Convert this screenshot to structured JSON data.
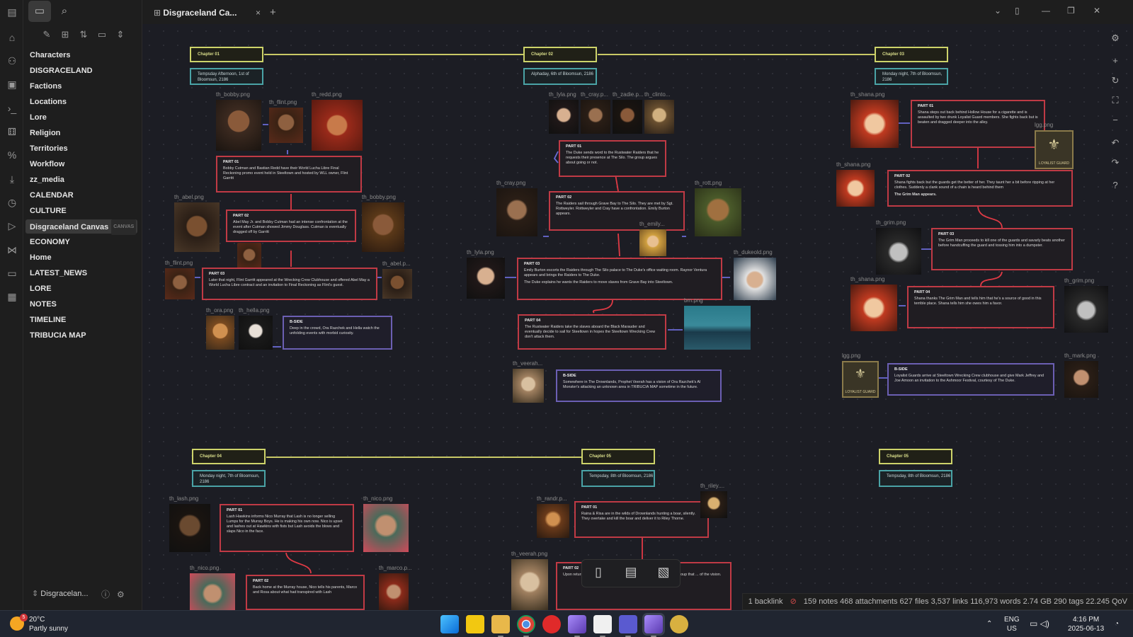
{
  "sidebar": {
    "items": [
      {
        "label": "Characters"
      },
      {
        "label": "DISGRACELAND"
      },
      {
        "label": "Factions"
      },
      {
        "label": "Locations"
      },
      {
        "label": "Lore"
      },
      {
        "label": "Religion"
      },
      {
        "label": "Territories"
      },
      {
        "label": "Workflow"
      },
      {
        "label": "zz_media"
      },
      {
        "label": "CALENDAR"
      },
      {
        "label": "CULTURE"
      },
      {
        "label": "Disgraceland Canvas",
        "badge": "CANVAS"
      },
      {
        "label": "ECONOMY"
      },
      {
        "label": "Home"
      },
      {
        "label": "LATEST_NEWS"
      },
      {
        "label": "LORE"
      },
      {
        "label": "NOTES"
      },
      {
        "label": "TIMELINE"
      },
      {
        "label": "TRIBUCIA MAP"
      }
    ],
    "vault_name": "Disgracelan..."
  },
  "tab": {
    "title": "Disgraceland Ca...",
    "close": "×",
    "add": "+"
  },
  "canvas": {
    "chapters": [
      {
        "label": "Chapter 01",
        "date": "Tempsday Afternoon, 1st of Bloomsun, 2186"
      },
      {
        "label": "Chapter 02",
        "date": "Alphaday, 6th of Bloomsun, 2186"
      },
      {
        "label": "Chapter 03",
        "date": "Monday night, 7th of Bloomsun, 2186"
      },
      {
        "label": "Chapter 04",
        "date": "Monday night, 7th of Bloomsun, 2186"
      },
      {
        "label": "Chapter 05",
        "date": "Tempsday, 8th of Bloomsun, 2186"
      },
      {
        "label": "Chapter 05",
        "date": "Tempsday, 8th of Bloomsun, 2186"
      }
    ],
    "images": {
      "c1_bobby": "th_bobby.png",
      "c1_flint": "th_flint.png",
      "c1_redd": "th_redd.png",
      "c1_abel": "th_abel.png",
      "c1_bobby2": "th_bobby.png",
      "c1_flint2": "th_flint.png",
      "c1_abel2": "th_abel.p...",
      "c1_ora": "th_ora.png",
      "c1_hella": "th_hella.png",
      "c2_lyla": "th_lyla.png",
      "c2_cray": "th_cray.p...",
      "c2_zadie": "th_zadie.p...",
      "c2_clinton": "th_clinto...",
      "c2_cray2": "th_cray.png",
      "c2_rott": "th_rott.png",
      "c2_emily": "th_emily...",
      "c2_lyla2": "th_lyla.png",
      "c2_dukeold": "th_dukeold.png",
      "c2_bm": "bm.png",
      "c2_veerah": "th_veerah...",
      "c3_shana": "th_shana.png",
      "c3_lgg": "lgg.png",
      "c3_shana2": "th_shana.png",
      "c3_grim": "th_grim.png",
      "c3_lgg2": "lgg.png",
      "c3_shana3": "th_shana.png",
      "c3_grim2": "th_grim.png",
      "c3_lgg3": "lgg.png",
      "c3_mark": "th_mark.png",
      "c4_lash": "th_lash.png",
      "c4_nico": "th_nico.png",
      "c4_nico2": "th_nico.png",
      "c4_marco": "th_marco.p...",
      "c5_randr": "th_randr.p...",
      "c5_riley": "th_riley....",
      "c5_veerah": "th_veerah.png"
    },
    "badge_text": "LOYALIST GUARD",
    "cards": {
      "c1p1": {
        "title": "PART 01",
        "text": "Bobby Cutman and Bastian Redd have their World Lucha Libre Final Reckoning promo event held in Steeltown and hosted by WLL owner, Flint Garritt"
      },
      "c1p2": {
        "title": "PART 02",
        "text": "Abel May Jr. and Bobby Cutman had an intense confrontation at the event after Cutman showed Jimmy Douglass. Cutman is eventually dragged off by Garritt"
      },
      "c1p3": {
        "title": "PART 03",
        "text": "Later that night, Flint Garritt appeared at the Wrecking Crew Clubhouse and offered Abel May a World Lucha Libre contract and an invitation to Final Reckoning as Flint's guest."
      },
      "c1b": {
        "title": "B-SIDE",
        "text": "Deep in the crowd, Ora Razchek and Hella watch the unfolding events with morbid curiosity."
      },
      "c2p1": {
        "title": "PART 01",
        "text": "The Duke sends word to the Rustwater Raiders that he requests their presence at The Silo. The group argues about going or not."
      },
      "c2p2": {
        "title": "PART 02",
        "text": "The Raiders sail through Grave Bay to The Silo. They are met by Sgt. Rottweyler. Rottweyler and Cray have a confrontation. Emily Burton appears."
      },
      "c2p3": {
        "title": "PART 03",
        "text": "Emily Burton escorts the Raiders through The Silo palace to The Duke's office waiting room. Raynor Ventura appears and brings the Raiders to The Duke.",
        "text2": "The Duke explains he wants the Raiders to move slaves from Grave Bay into Steeltown."
      },
      "c2p4": {
        "title": "PART 04",
        "text": "The Rustwater Raiders take the slaves aboard the Black Marauder and eventually decide to sail for Steeltown in hopes the Steeltown Wrecking Crew don't attack them."
      },
      "c2b": {
        "title": "B-SIDE",
        "text": "Somewhere in The Drownlands, Prophet Veerah has a vision of Ora Razchek's AI Monster's attacking an unknown area in TRIBUCIA MAP sometime in the future."
      },
      "c3p1": {
        "title": "PART 01",
        "text": "Shana steps out back behind Hollow House for a cigarette and is assaulted by two drunk Loyalist Guard members. She fights back but is beaten and dragged deeper into the alley."
      },
      "c3p2": {
        "title": "PART 02",
        "text": "Shana fights back but the guards get the better of her. They taunt her a bit before ripping at her clothes. Suddenly a clank sound of a chain is heard behind them",
        "text2": "The Grim Man appears."
      },
      "c3p3": {
        "title": "PART 03",
        "text": "The Grim Man proceeds to kill one of the guards and savarly beats another before handcuffing the guard and tossing him into a dumpster."
      },
      "c3p4": {
        "title": "PART 04",
        "text": "Shana thanks The Grim Man and tells him that he's a source of good in this terrible place. Shana tells him she owes him a favor."
      },
      "c3b": {
        "title": "B-SIDE",
        "text": "Loyalist Guards arrive at Steeltown Wrecking Crew clubhouse and give Mark Jeffrey and Joe Amoon an invitation to the Ashmoor Festival, courtesy of The Duke."
      },
      "c4p1": {
        "title": "PART 01",
        "text": "Lash Hawkins informs Nico Murray that Lash is no longer selling Lumps for the Murray Boys. He is making his own now. Nico is upset and lashes out at Hawkins with fists but Lash avoids the blows and slaps Nico in the face."
      },
      "c4p2": {
        "title": "PART 02",
        "text": "Back home at the Murray house, Nico tells his parents, Marco and Rosa about what had transpired with Lash"
      },
      "c5p1": {
        "title": "PART 01",
        "text": "Raina & Risa are in the wilds of Drownlands hunting a boar, silently. They overtake and kill the boar and deliver it to Riley Thorne."
      },
      "c5p2": {
        "title": "PART 02",
        "text": "Upon return ... Prophet Ve... Ora Razchek's AI Monsters ... tells the group that ... of the vision."
      }
    }
  },
  "status": {
    "backlinks": "1 backlink",
    "stats": "159 notes 468 attachments 627 files 3,537 links 116,973 words 2.74 GB 290 tags 22.245 QoV"
  },
  "taskbar": {
    "weather_temp": "20°C",
    "weather_desc": "Partly sunny",
    "weather_badge": "5",
    "lang1": "ENG",
    "lang2": "US",
    "time": "4:16 PM",
    "date": "2025-06-13"
  },
  "colors": {
    "chapter": "#cdd36a",
    "date": "#4aa3a6",
    "part": "#c03a45",
    "bside": "#6b5fb3",
    "link": "#e0e070"
  }
}
